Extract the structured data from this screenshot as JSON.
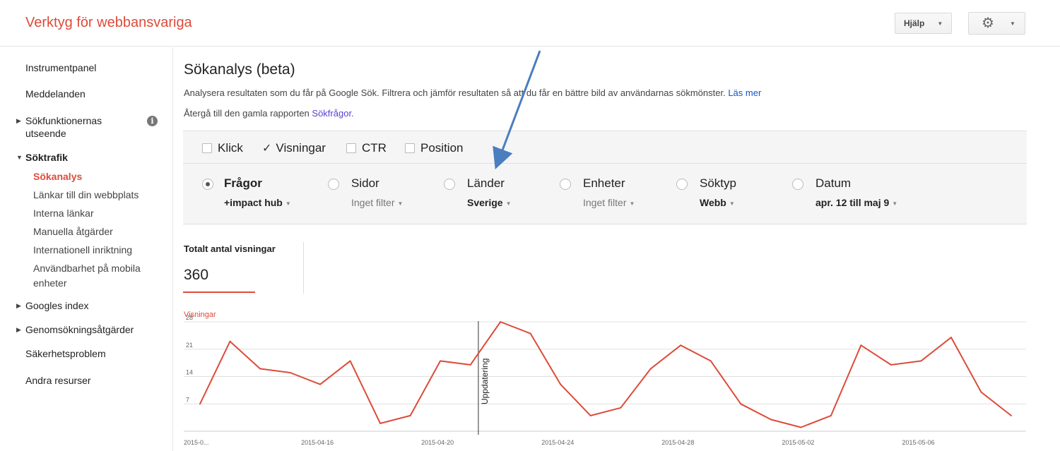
{
  "header": {
    "app_title": "Verktyg för webbansvariga",
    "help_label": "Hjälp",
    "gear_icon": "gear-icon"
  },
  "sidebar": {
    "items": [
      {
        "label": "Instrumentpanel"
      },
      {
        "label": "Meddelanden"
      },
      {
        "label_line1": "Sökfunktionernas",
        "label_line2": "utseende"
      },
      {
        "label": "Söktrafik"
      },
      {
        "label": "Googles index"
      },
      {
        "label": "Genomsökningsåtgärder"
      },
      {
        "label": "Säkerhetsproblem"
      },
      {
        "label": "Andra resurser"
      }
    ],
    "subitems": [
      {
        "label": "Sökanalys"
      },
      {
        "label": "Länkar till din webbplats"
      },
      {
        "label": "Interna länkar"
      },
      {
        "label": "Manuella åtgärder"
      },
      {
        "label": "Internationell inriktning"
      },
      {
        "label_line1": "Användbarhet på mobila",
        "label_line2": "enheter"
      }
    ]
  },
  "main": {
    "title": "Sökanalys (beta)",
    "description": "Analysera resultaten som du får på Google Sök. Filtrera och jämför resultaten så att du får en bättre bild av användarnas sökmönster.",
    "learn_more": "Läs mer",
    "back_text": "Återgå till den gamla rapporten",
    "back_link": "Sökfrågor."
  },
  "metrics": [
    {
      "label": "Klick",
      "checked": false
    },
    {
      "label": "Visningar",
      "checked": true
    },
    {
      "label": "CTR",
      "checked": false
    },
    {
      "label": "Position",
      "checked": false
    }
  ],
  "dimensions": [
    {
      "label": "Frågor",
      "filter": "+impact hub",
      "selected": true
    },
    {
      "label": "Sidor",
      "filter": "Inget filter",
      "selected": false
    },
    {
      "label": "Länder",
      "filter": "Sverige",
      "selected": false
    },
    {
      "label": "Enheter",
      "filter": "Inget filter",
      "selected": false
    },
    {
      "label": "Söktyp",
      "filter": "Webb",
      "selected": false
    },
    {
      "label": "Datum",
      "filter": "apr. 12 till maj 9",
      "selected": false
    }
  ],
  "total": {
    "label": "Totalt antal visningar",
    "value": "360"
  },
  "chart_data": {
    "type": "line",
    "ylabel": "Visningar",
    "ylim": [
      0,
      28
    ],
    "yticks": [
      "7",
      "14",
      "21",
      "28"
    ],
    "xtick_labels": [
      "2015-0...",
      "2015-04-16",
      "2015-04-20",
      "2015-04-24",
      "2015-04-28",
      "2015-05-02",
      "2015-05-06"
    ],
    "annotation": "Uppdatering",
    "series": [
      {
        "color": "#dd4b39",
        "x": [
          "2015-04-12",
          "2015-04-13",
          "2015-04-14",
          "2015-04-15",
          "2015-04-16",
          "2015-04-17",
          "2015-04-18",
          "2015-04-19",
          "2015-04-20",
          "2015-04-21",
          "2015-04-22",
          "2015-04-23",
          "2015-04-24",
          "2015-04-25",
          "2015-04-26",
          "2015-04-27",
          "2015-04-28",
          "2015-04-29",
          "2015-04-30",
          "2015-05-01",
          "2015-05-02",
          "2015-05-03",
          "2015-05-04",
          "2015-05-05",
          "2015-05-06",
          "2015-05-07",
          "2015-05-08",
          "2015-05-09"
        ],
        "values": [
          7,
          23,
          16,
          15,
          12,
          18,
          2,
          4,
          18,
          17,
          28,
          25,
          12,
          4,
          6,
          16,
          22,
          18,
          7,
          3,
          1,
          4,
          22,
          17,
          18,
          24,
          10,
          4
        ]
      }
    ]
  }
}
